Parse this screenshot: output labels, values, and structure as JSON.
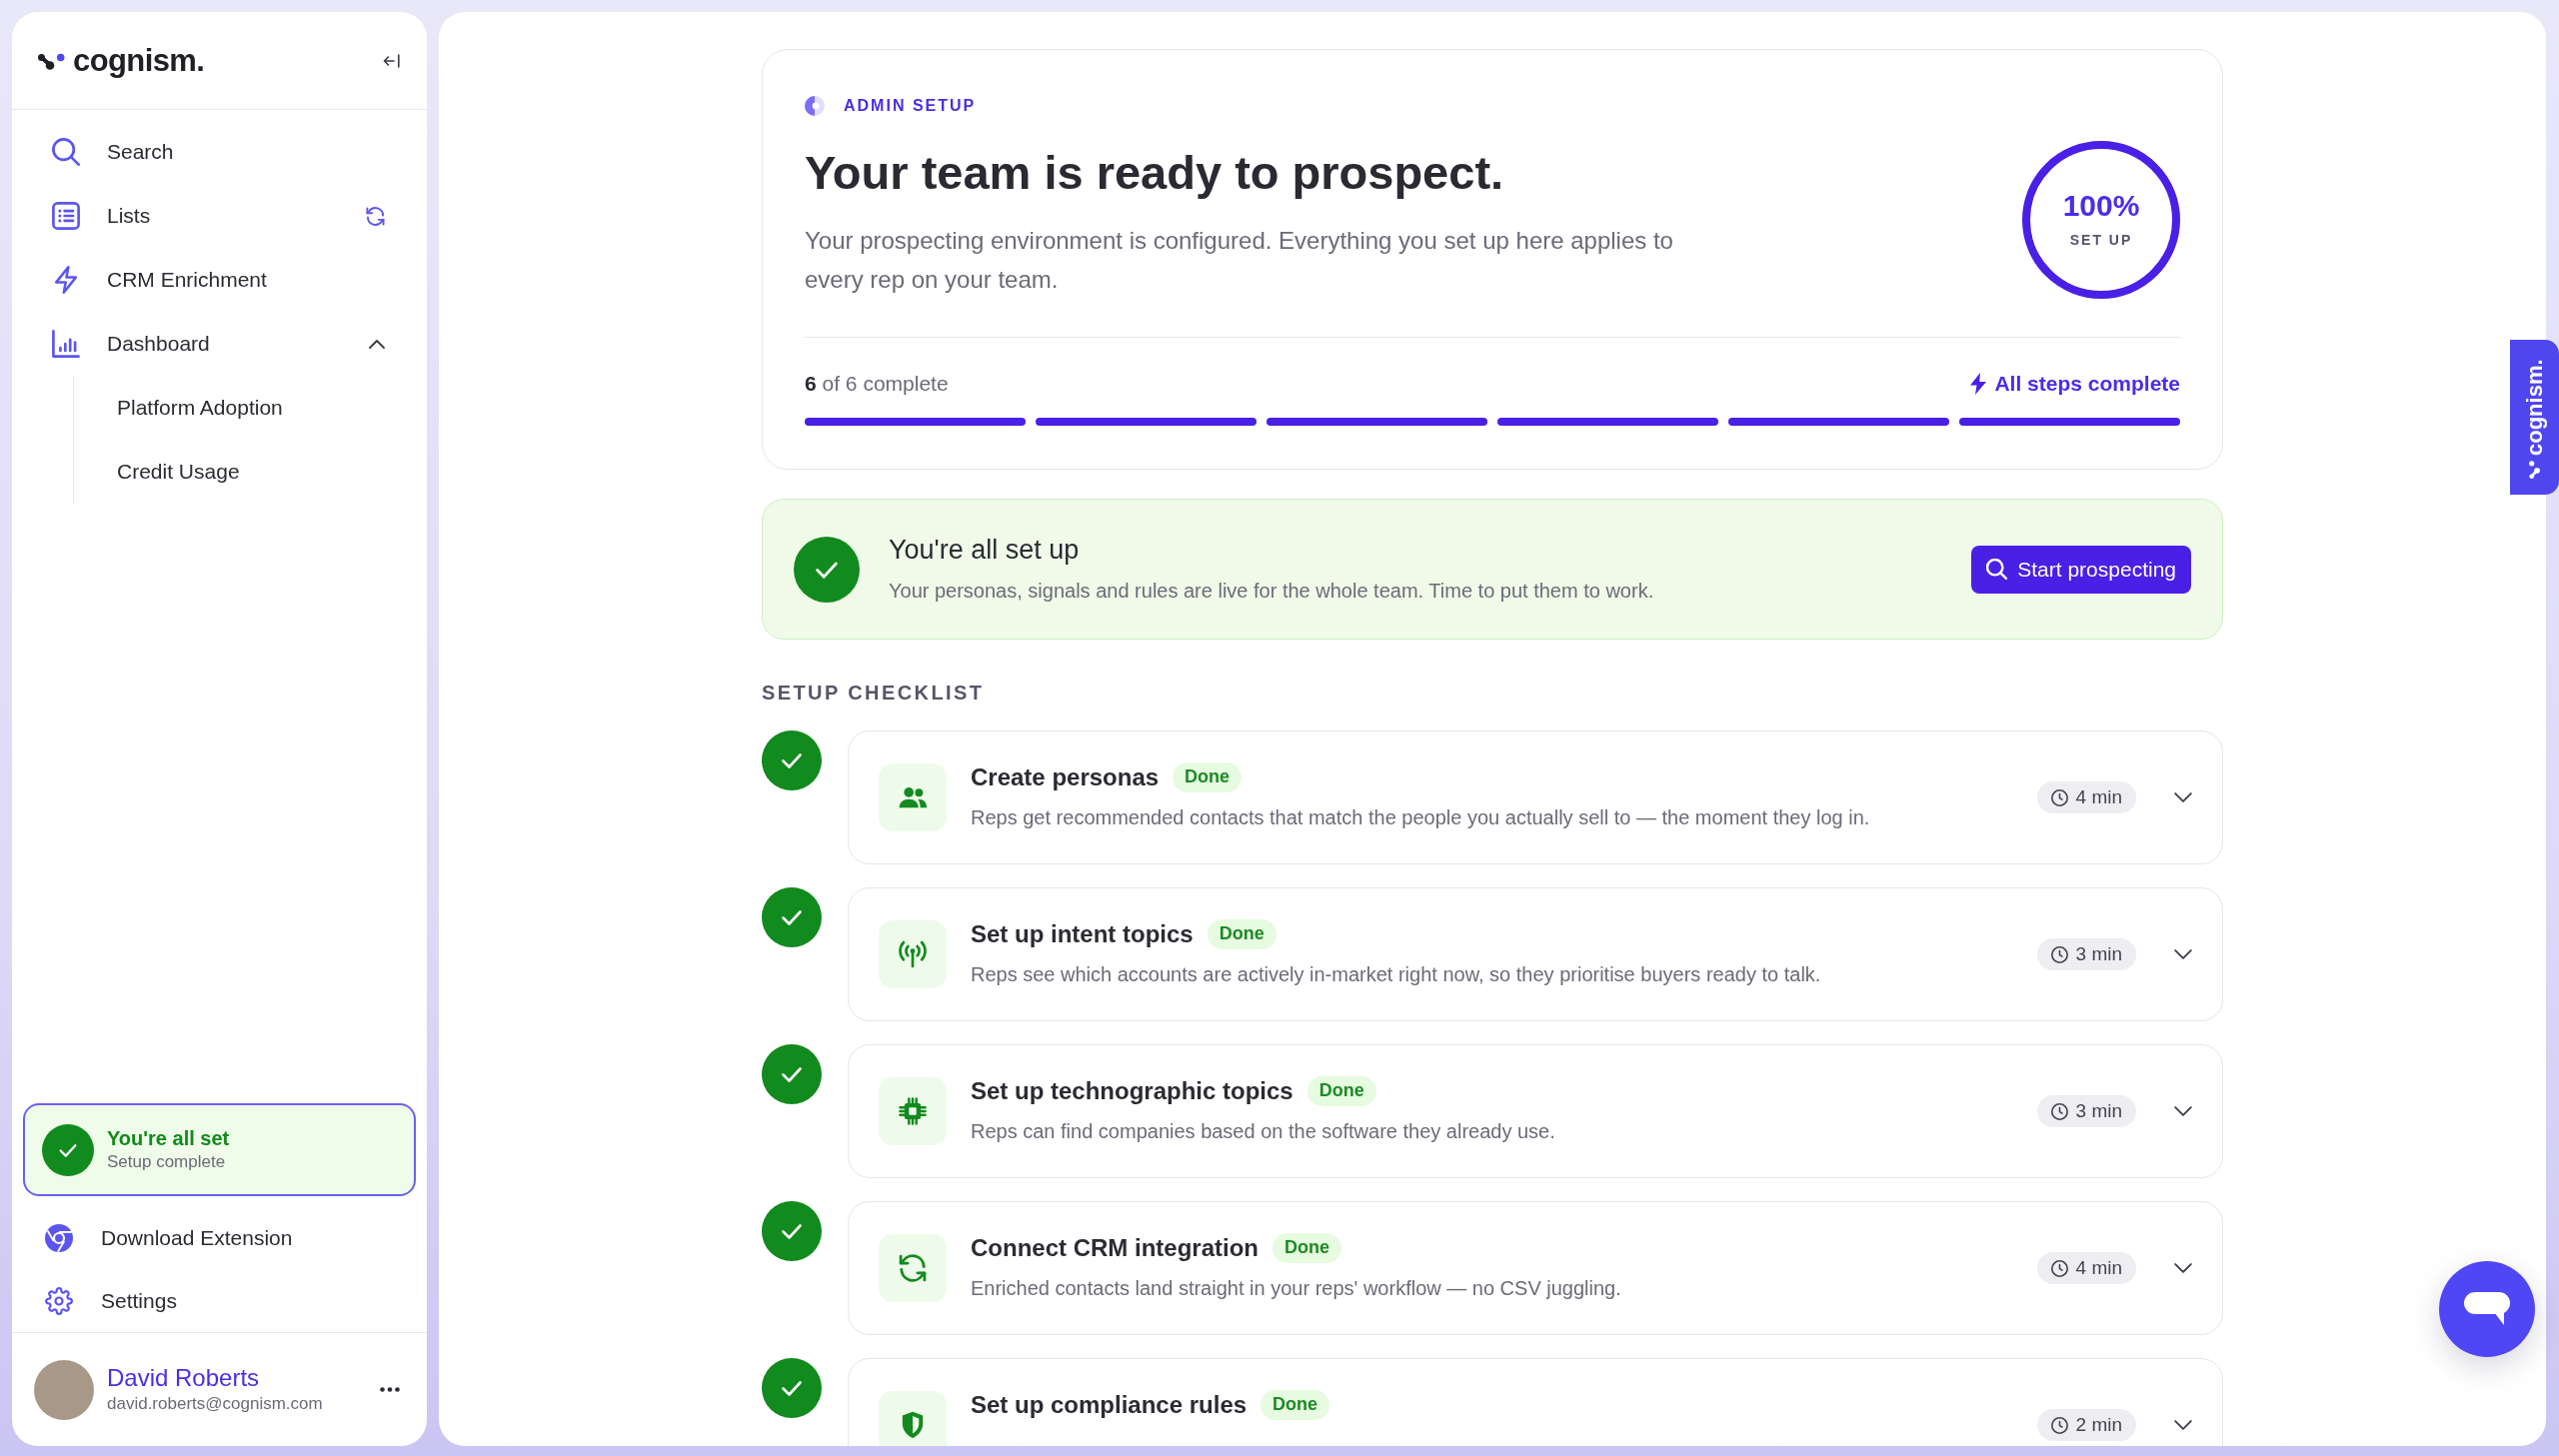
{
  "sidebar": {
    "logo": "cognism.",
    "nav_items": [
      {
        "label": "Search"
      },
      {
        "label": "Lists"
      },
      {
        "label": "CRM Enrichment"
      },
      {
        "label": "Dashboard",
        "expanded": true,
        "children": [
          {
            "label": "Platform Adoption"
          },
          {
            "label": "Credit Usage"
          }
        ]
      }
    ],
    "setup_status": {
      "title": "You're all set",
      "subtitle": "Setup complete"
    },
    "footer_items": [
      {
        "label": "Download Extension"
      },
      {
        "label": "Settings"
      }
    ],
    "user": {
      "name": "David Roberts",
      "email": "david.roberts@cognism.com"
    }
  },
  "header_card": {
    "eyebrow": "ADMIN SETUP",
    "title": "Your team is ready to prospect.",
    "description": "Your prospecting environment is configured. Everything you set up here applies to every rep on your team.",
    "ring": {
      "value": "100%",
      "label": "SET UP",
      "level": 1
    },
    "progress_text": "**6** of 6 complete",
    "status": "All steps complete",
    "steps": [
      {
        "complete": true
      },
      {
        "complete": true
      },
      {
        "complete": true
      },
      {
        "complete": true
      },
      {
        "complete": true
      },
      {
        "complete": true
      }
    ]
  },
  "banner": {
    "title": "You're all set up",
    "description": "Your personas, signals and rules are live for the whole team. Time to put them to work.",
    "button": "Start prospecting"
  },
  "checklist": {
    "heading": "SETUP CHECKLIST",
    "items": [
      {
        "title": "Create personas",
        "status": "Done",
        "description": "Reps get recommended contacts that match the people you actually sell to — the moment they log in.",
        "duration": "4 min",
        "done": true,
        "expanded": false
      },
      {
        "title": "Set up intent topics",
        "status": "Done",
        "description": "Reps see which accounts are actively in-market right now, so they prioritise buyers ready to talk.",
        "duration": "3 min",
        "done": true,
        "expanded": false
      },
      {
        "title": "Set up technographic topics",
        "status": "Done",
        "description": "Reps can find companies based on the software they already use.",
        "duration": "3 min",
        "done": true,
        "expanded": false
      },
      {
        "title": "Connect CRM integration",
        "status": "Done",
        "description": "Enriched contacts land straight in your reps' workflow — no CSV juggling.",
        "duration": "4 min",
        "done": true,
        "expanded": false
      },
      {
        "title": "Set up compliance rules",
        "status": "Done",
        "duration": "2 min",
        "done": true,
        "expanded": false
      }
    ]
  },
  "side_tab": {
    "label": "cognism."
  }
}
